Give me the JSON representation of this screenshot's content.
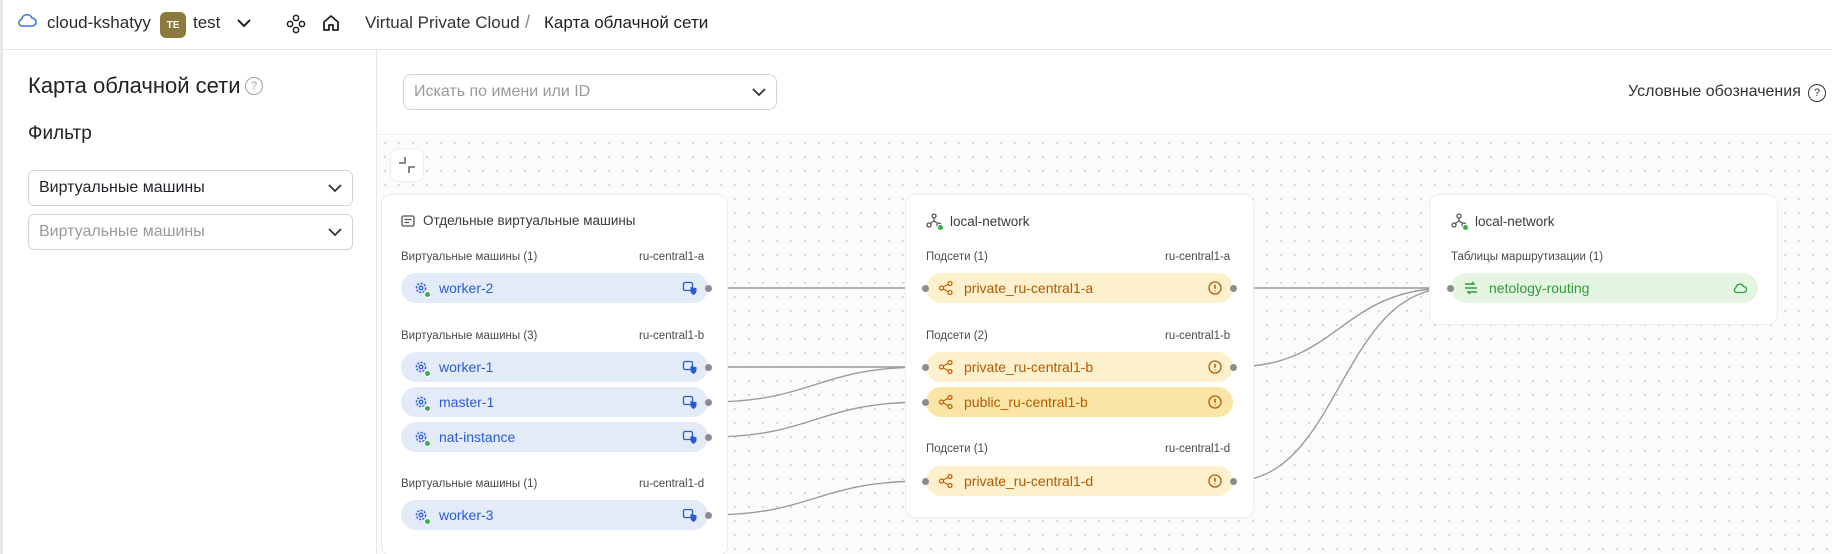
{
  "topbar": {
    "cloud_name": "cloud-kshatyy",
    "folder_avatar": "TE",
    "folder_name": "test",
    "breadcrumb_service": "Virtual Private Cloud",
    "breadcrumb_sep": "/",
    "breadcrumb_page": "Карта облачной сети"
  },
  "sidebar": {
    "title": "Карта облачной сети",
    "filter_label": "Фильтр",
    "filter_type_value": "Виртуальные машины",
    "filter_items_placeholder": "Виртуальные машины"
  },
  "toolbar": {
    "search_placeholder": "Искать по имени или ID",
    "legend_label": "Условные обозначения"
  },
  "vm_card": {
    "title": "Отдельные виртуальные машины",
    "groups": [
      {
        "label": "Виртуальные машины (1)",
        "zone": "ru-central1-a",
        "items": [
          "worker-2"
        ]
      },
      {
        "label": "Виртуальные машины (3)",
        "zone": "ru-central1-b",
        "items": [
          "worker-1",
          "master-1",
          "nat-instance"
        ]
      },
      {
        "label": "Виртуальные машины (1)",
        "zone": "ru-central1-d",
        "items": [
          "worker-3"
        ]
      }
    ]
  },
  "network_card": {
    "title": "local-network",
    "groups": [
      {
        "label": "Подсети (1)",
        "zone": "ru-central1-a",
        "items": [
          "private_ru-central1-a"
        ]
      },
      {
        "label": "Подсети (2)",
        "zone": "ru-central1-b",
        "items": [
          "private_ru-central1-b",
          "public_ru-central1-b"
        ]
      },
      {
        "label": "Подсети (1)",
        "zone": "ru-central1-d",
        "items": [
          "private_ru-central1-d"
        ]
      }
    ]
  },
  "routing_card": {
    "title": "local-network",
    "group_label": "Таблицы маршрутизации (1)",
    "items": [
      "netology-routing"
    ]
  },
  "colors": {
    "vm_fill": "#e3eaf8",
    "vm_text": "#2b5bd1",
    "subnet_fill": "#fdf0cc",
    "subnet_text": "#b35a00",
    "route_fill": "#e4f5e2",
    "route_text": "#2f9c3a"
  }
}
